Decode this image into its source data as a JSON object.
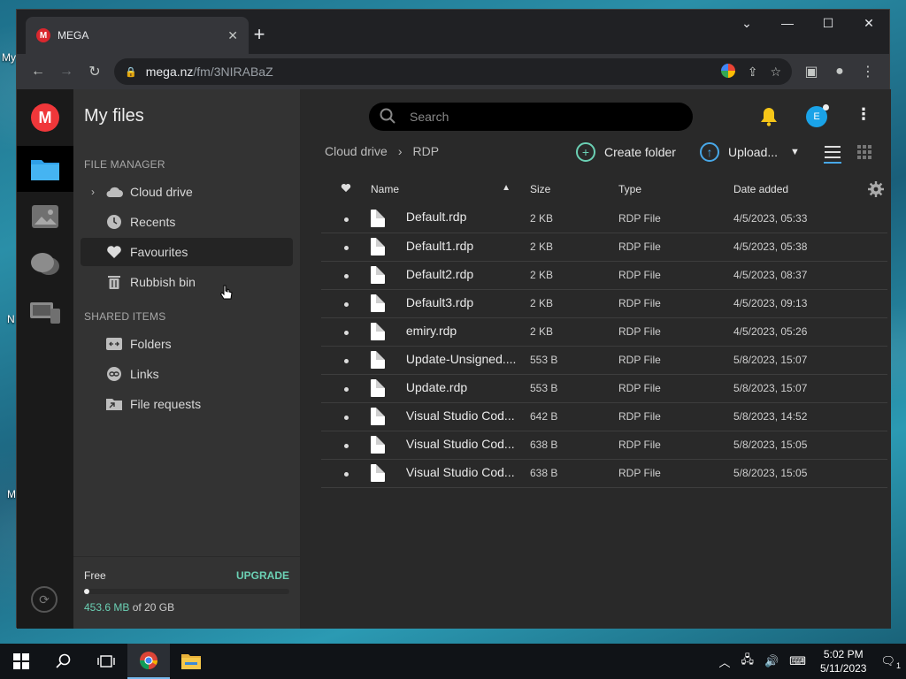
{
  "desktop": {
    "labels": [
      "My",
      "N",
      "M"
    ]
  },
  "browser": {
    "tab_title": "MEGA",
    "favicon_letter": "M",
    "new_tab_symbol": "+",
    "url_host": "mega.nz",
    "url_path": "/fm/3NIRABaZ"
  },
  "app": {
    "logo_letter": "M",
    "sidebar": {
      "title": "My files",
      "file_manager_heading": "FILE MANAGER",
      "file_manager_items": [
        {
          "label": "Cloud drive",
          "icon": "cloud-icon"
        },
        {
          "label": "Recents",
          "icon": "clock-icon"
        },
        {
          "label": "Favourites",
          "icon": "heart-icon"
        },
        {
          "label": "Rubbish bin",
          "icon": "trash-icon"
        }
      ],
      "shared_heading": "SHARED ITEMS",
      "shared_items": [
        {
          "label": "Folders",
          "icon": "shared-folder-icon"
        },
        {
          "label": "Links",
          "icon": "link-icon"
        },
        {
          "label": "File requests",
          "icon": "file-request-icon"
        }
      ],
      "plan": "Free",
      "upgrade": "UPGRADE",
      "used": "453.6 MB",
      "total": "of 20 GB",
      "storage_fraction": 0.022
    },
    "search_placeholder": "Search",
    "avatar_letter": "E",
    "breadcrumb": [
      "Cloud drive",
      "RDP"
    ],
    "create_folder": "Create folder",
    "upload": "Upload...",
    "columns": [
      "Name",
      "Size",
      "Type",
      "Date added"
    ],
    "files": [
      {
        "name": "Default.rdp",
        "size": "2 KB",
        "type": "RDP File",
        "date": "4/5/2023, 05:33"
      },
      {
        "name": "Default1.rdp",
        "size": "2 KB",
        "type": "RDP File",
        "date": "4/5/2023, 05:38"
      },
      {
        "name": "Default2.rdp",
        "size": "2 KB",
        "type": "RDP File",
        "date": "4/5/2023, 08:37"
      },
      {
        "name": "Default3.rdp",
        "size": "2 KB",
        "type": "RDP File",
        "date": "4/5/2023, 09:13"
      },
      {
        "name": "emiry.rdp",
        "size": "2 KB",
        "type": "RDP File",
        "date": "4/5/2023, 05:26"
      },
      {
        "name": "Update-Unsigned....",
        "size": "553 B",
        "type": "RDP File",
        "date": "5/8/2023, 15:07"
      },
      {
        "name": "Update.rdp",
        "size": "553 B",
        "type": "RDP File",
        "date": "5/8/2023, 15:07"
      },
      {
        "name": "Visual Studio Cod...",
        "size": "642 B",
        "type": "RDP File",
        "date": "5/8/2023, 14:52"
      },
      {
        "name": "Visual Studio Cod...",
        "size": "638 B",
        "type": "RDP File",
        "date": "5/8/2023, 15:05"
      },
      {
        "name": "Visual Studio Cod...",
        "size": "638 B",
        "type": "RDP File",
        "date": "5/8/2023, 15:05"
      }
    ],
    "colors": {
      "accent_green": "#6bd0b4",
      "mega_red": "#f0373a"
    }
  },
  "taskbar": {
    "time": "5:02 PM",
    "date": "5/11/2023",
    "notification_count": "1"
  }
}
